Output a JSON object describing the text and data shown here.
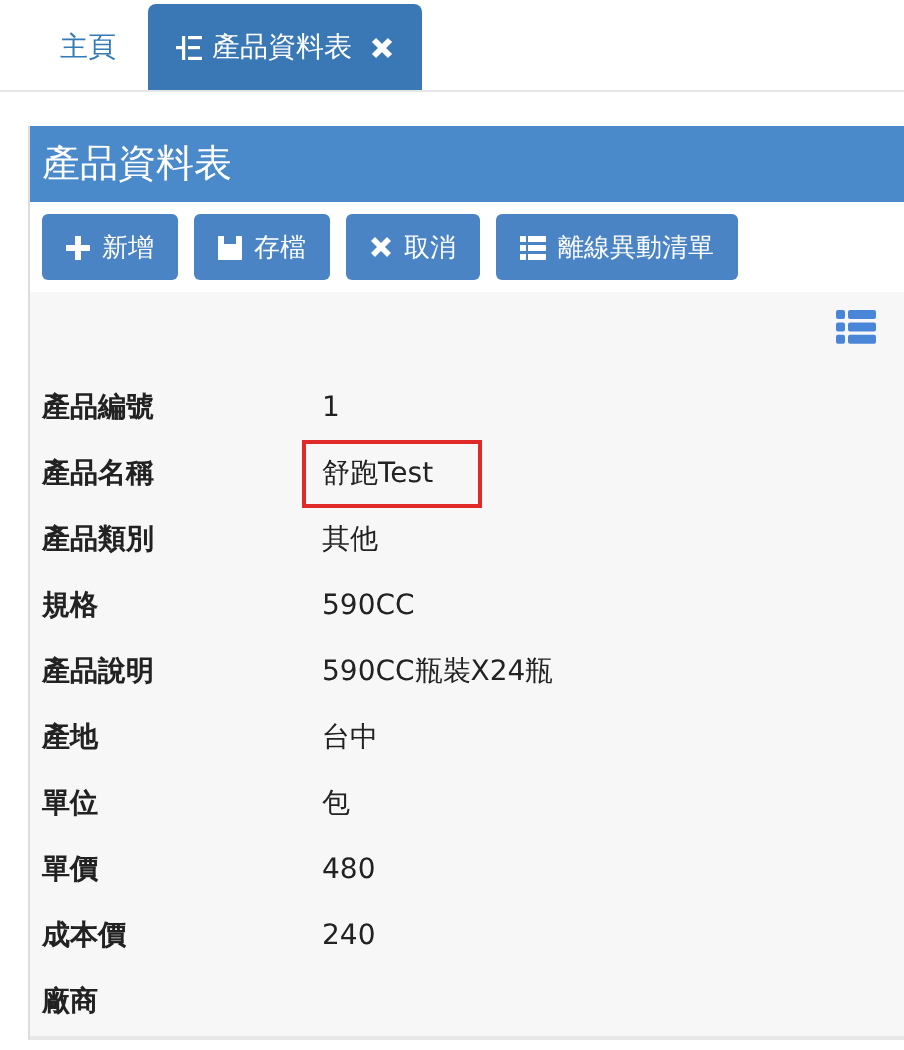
{
  "tabs": [
    {
      "label": "主頁",
      "selected": false,
      "kind": "plain",
      "closable": false
    },
    {
      "label": "產品資料表",
      "selected": true,
      "kind": "tree",
      "closable": true
    }
  ],
  "panel": {
    "title": "產品資料表",
    "buttons": [
      {
        "label": "新增",
        "kind": "plus"
      },
      {
        "label": "存檔",
        "kind": "save"
      },
      {
        "label": "取消",
        "kind": "times"
      },
      {
        "label": "離線異動清單",
        "kind": "list"
      }
    ],
    "fields": [
      {
        "label": "產品編號",
        "value": "1",
        "highlighted": false
      },
      {
        "label": "產品名稱",
        "value": "舒跑Test",
        "highlighted": true
      },
      {
        "label": "產品類別",
        "value": "其他",
        "highlighted": false
      },
      {
        "label": "規格",
        "value": "590CC",
        "highlighted": false
      },
      {
        "label": "產品說明",
        "value": "590CC瓶裝X24瓶",
        "highlighted": false
      },
      {
        "label": "產地",
        "value": "台中",
        "highlighted": false
      },
      {
        "label": "單位",
        "value": "包",
        "highlighted": false
      },
      {
        "label": "單價",
        "value": "480",
        "highlighted": false
      },
      {
        "label": "成本價",
        "value": "240",
        "highlighted": false
      },
      {
        "label": "廠商",
        "highlighted": false
      }
    ]
  }
}
